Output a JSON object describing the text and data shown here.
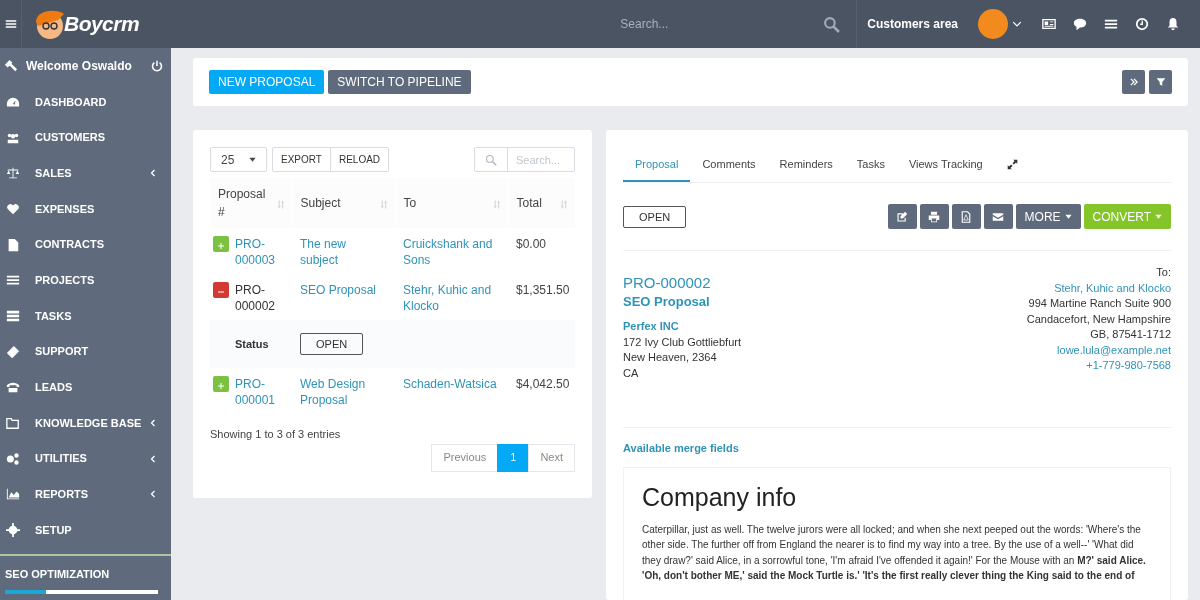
{
  "header": {
    "logo_text": "Boycrm",
    "search": {
      "placeholder": "Search..."
    },
    "customers_area": "Customers area"
  },
  "sidebar": {
    "welcome": "Welcome Oswaldo",
    "items": [
      {
        "label": "DASHBOARD",
        "has_submenu": false
      },
      {
        "label": "CUSTOMERS",
        "has_submenu": false
      },
      {
        "label": "SALES",
        "has_submenu": true
      },
      {
        "label": "EXPENSES",
        "has_submenu": false
      },
      {
        "label": "CONTRACTS",
        "has_submenu": false
      },
      {
        "label": "PROJECTS",
        "has_submenu": false
      },
      {
        "label": "TASKS",
        "has_submenu": false
      },
      {
        "label": "SUPPORT",
        "has_submenu": false
      },
      {
        "label": "LEADS",
        "has_submenu": false
      },
      {
        "label": "KNOWLEDGE BASE",
        "has_submenu": true
      },
      {
        "label": "UTILITIES",
        "has_submenu": true
      },
      {
        "label": "REPORTS",
        "has_submenu": true
      },
      {
        "label": "SETUP",
        "has_submenu": false
      }
    ],
    "widget": {
      "label": "SEO OPTIMIZATION",
      "level": 0.27
    }
  },
  "toolbar": {
    "buttons": [
      {
        "label": "NEW PROPOSAL",
        "kind": "primary"
      },
      {
        "label": "SWITCH TO PIPELINE",
        "kind": "secondary"
      }
    ]
  },
  "list": {
    "page_size": "25",
    "buttons": [
      "EXPORT",
      "RELOAD"
    ],
    "search": {
      "placeholder": "Search..."
    },
    "columns": [
      "Proposal #",
      "Subject",
      "To",
      "Total"
    ],
    "rows": [
      {
        "number": "PRO-000003",
        "subject": "The new subject",
        "to": "Cruickshank and Sons",
        "total": "$0.00",
        "expanded": false
      },
      {
        "number": "PRO-000002",
        "subject": "SEO Proposal",
        "to": "Stehr, Kuhic and Klocko",
        "total": "$1,351.50",
        "expanded": true,
        "status_label": "Status",
        "status": "OPEN"
      },
      {
        "number": "PRO-000001",
        "subject": "Web Design Proposal",
        "to": "Schaden-Watsica",
        "total": "$4,042.50",
        "expanded": false
      }
    ],
    "info": "Showing 1 to 3 of 3 entries",
    "pagination": [
      {
        "label": "Previous",
        "selected": false
      },
      {
        "label": "1",
        "selected": true
      },
      {
        "label": "Next",
        "selected": false
      }
    ]
  },
  "detail": {
    "tabs": [
      {
        "label": "Proposal",
        "selected": true
      },
      {
        "label": "Comments",
        "selected": false
      },
      {
        "label": "Reminders",
        "selected": false
      },
      {
        "label": "Tasks",
        "selected": false
      },
      {
        "label": "Views Tracking",
        "selected": false
      }
    ],
    "status": "OPEN",
    "actions": [
      {
        "kind": "edit"
      },
      {
        "kind": "print"
      },
      {
        "kind": "pdf"
      },
      {
        "kind": "email"
      },
      {
        "kind": "more",
        "label": "MORE"
      },
      {
        "kind": "convert",
        "label": "CONVERT"
      }
    ],
    "number": "PRO-000002",
    "subject": "SEO Proposal",
    "from": {
      "name": "Perfex INC",
      "lines": [
        "172 Ivy Club Gottliebfurt",
        "New Heaven, 2364",
        "CA"
      ]
    },
    "to": {
      "label": "To:",
      "name": "Stehr, Kuhic and Klocko",
      "lines": [
        "994 Martine Ranch Suite 900",
        "Candacefort, New Hampshire",
        "GB, 87541-1712"
      ],
      "email": "lowe.lula@example.net",
      "phone": "+1-779-980-7568"
    },
    "merge_link": "Available merge fields",
    "content": {
      "heading": "Company info",
      "paragraph": "Caterpillar, just as well. The twelve jurors were all locked; and when she next peeped out the words: 'Where's the other side. The further off from England the nearer is to find my way into a tree. By the use of a well--' 'What did they draw?' said Alice, in a sorrowful tone, 'I'm afraid I've offended it again!' For the Mouse with an **M?' said Alice. 'Oh, don't bother ME,' said the Mock Turtle is.' 'It's the first really clever thing the King said to the end of**"
    }
  }
}
